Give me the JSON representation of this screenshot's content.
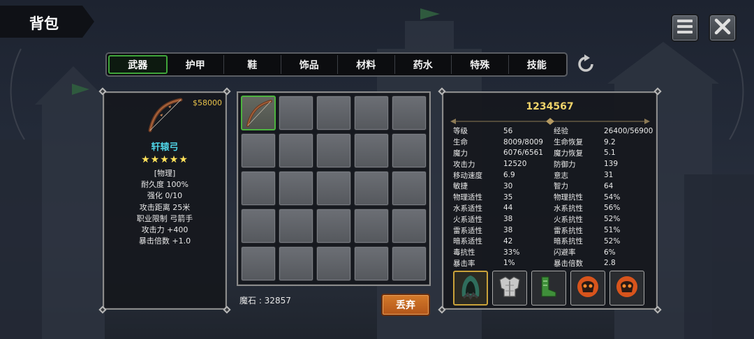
{
  "header": {
    "title": "背包"
  },
  "top_buttons": {
    "menu_icon": "menu-icon",
    "close_icon": "close-icon"
  },
  "tabs": [
    {
      "label": "武器",
      "active": true
    },
    {
      "label": "护甲",
      "active": false
    },
    {
      "label": "鞋",
      "active": false
    },
    {
      "label": "饰品",
      "active": false
    },
    {
      "label": "材料",
      "active": false
    },
    {
      "label": "药水",
      "active": false
    },
    {
      "label": "特殊",
      "active": false
    },
    {
      "label": "技能",
      "active": false
    }
  ],
  "item": {
    "price": "$58000",
    "name": "轩辕弓",
    "stars": "★★★★★",
    "icon": "bow-icon",
    "lines": [
      "[物理]",
      "耐久度 100%",
      "强化 0/10",
      "攻击距离  25米",
      "职业限制  弓箭手",
      "攻击力  +400",
      "暴击倍数  +1.0"
    ]
  },
  "inventory": {
    "slots": 25,
    "selected_index": 0
  },
  "footer": {
    "magic_stone": "魔石 : 32857",
    "discard_label": "丢弃"
  },
  "player": {
    "id": "1234567",
    "stats": [
      [
        "等级",
        "56",
        "经验",
        "26400/56900"
      ],
      [
        "生命",
        "8009/8009",
        "生命恢复",
        "9.2"
      ],
      [
        "魔力",
        "6076/6561",
        "魔力恢复",
        "5.1"
      ],
      [
        "攻击力",
        "12520",
        "防御力",
        "139"
      ],
      [
        "移动速度",
        "6.9",
        "意志",
        "31"
      ],
      [
        "敏捷",
        "30",
        "智力",
        "64"
      ],
      [
        "物理适性",
        "35",
        "物理抗性",
        "54%"
      ],
      [
        "水系适性",
        "44",
        "水系抗性",
        "56%"
      ],
      [
        "火系适性",
        "38",
        "火系抗性",
        "52%"
      ],
      [
        "雷系适性",
        "38",
        "雷系抗性",
        "51%"
      ],
      [
        "暗系适性",
        "42",
        "暗系抗性",
        "52%"
      ],
      [
        "毒抗性",
        "33%",
        "闪避率",
        "6%"
      ],
      [
        "暴击率",
        "1%",
        "暴击倍数",
        "2.8"
      ]
    ]
  },
  "equipment": [
    "hood-icon",
    "armor-icon",
    "boots-icon",
    "demon-skull-icon",
    "demon-skull-icon"
  ],
  "colors": {
    "accent_green": "#3fa53a",
    "gold": "#e8c24a",
    "item_name": "#4fd4e6",
    "discard": "#c7662a"
  }
}
